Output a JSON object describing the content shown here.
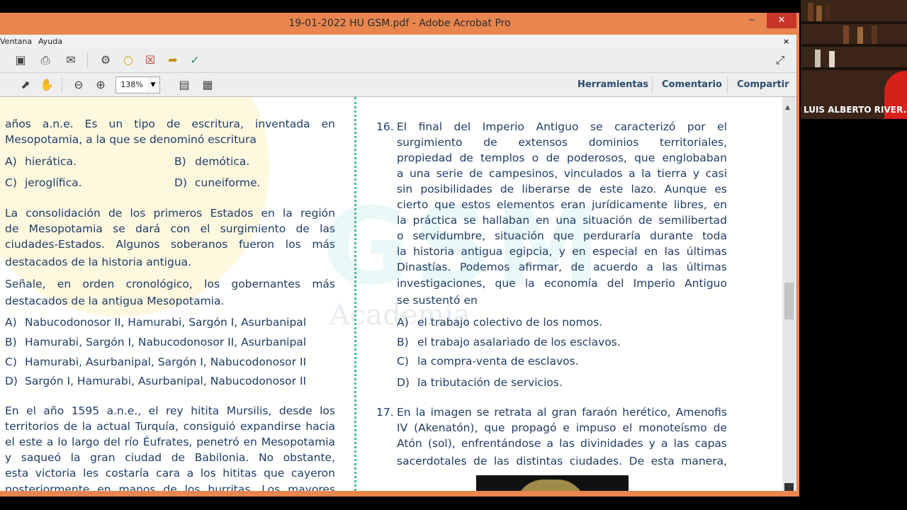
{
  "window": {
    "title": "19-01-2022 HU GSM.pdf - Adobe Acrobat Pro",
    "controls": {
      "minimize": "−",
      "maximize": "□",
      "close": "✕"
    }
  },
  "menu": {
    "items": [
      "Ventana",
      "Ayuda"
    ],
    "doc_close": "×"
  },
  "toolbar": {
    "zoom": "138%",
    "panels": [
      "Herramientas",
      "Comentario",
      "Compartir"
    ]
  },
  "left_column": {
    "intro_lines": [
      "años a.n.e. Es un tipo de escritura, inventada en",
      "Mesopotamia, a la que se denominó escritura"
    ],
    "q1_options": [
      {
        "letter": "A)",
        "text": "hierática."
      },
      {
        "letter": "B)",
        "text": "demótica."
      },
      {
        "letter": "C)",
        "text": "jeroglífica."
      },
      {
        "letter": "D)",
        "text": "cuneiforme."
      }
    ],
    "para1_lines": [
      "La consolidación de los primeros Estados en la región",
      "de Mesopotamia se dará con el surgimiento de las",
      "ciudades-Estados. Algunos soberanos fueron los más",
      "destacados de la historia antigua."
    ],
    "para2_lines": [
      "Señale, en orden cronológico, los gobernantes más",
      "destacados de la antigua Mesopotamia."
    ],
    "q2_options": [
      {
        "letter": "A)",
        "text": "Nabucodonosor II, Hamurabi, Sargón I, Asurbanipal"
      },
      {
        "letter": "B)",
        "text": "Hamurabi, Sargón I, Nabucodonosor II, Asurbanipal"
      },
      {
        "letter": "C)",
        "text": "Hamurabi, Asurbanipal, Sargón I, Nabucodonosor II"
      },
      {
        "letter": "D)",
        "text": "Sargón I, Hamurabi, Asurbanipal, Nabucodonosor II"
      }
    ],
    "para3_lines": [
      "En el año 1595 a.n.e., el rey hitita Mursilis, desde los",
      "territorios de la actual Turquía, consiguió expandirse hacia",
      "el este a lo largo del río Éufrates, penetró en Mesopotamia",
      "y saqueó la gran ciudad de Babilonia. No obstante,",
      "esta victoria les costaría cara a los hititas que cayeron",
      "posteriormente en manos de los hurritas. Los mayores"
    ]
  },
  "right_column": {
    "q16": {
      "number": "16.",
      "lines": [
        "El final del Imperio Antiguo se caracterizó por el",
        "surgimiento de extensos dominios territoriales,",
        "propiedad de templos o de poderosos, que englobaban",
        "a una serie de campesinos, vinculados a la tierra y casi",
        "sin posibilidades de liberarse de este lazo. Aunque es",
        "cierto que estos elementos eran jurídicamente libres, en",
        "la práctica se hallaban en una situación de semilibertad",
        "o servidumbre, situación que perduraría durante toda",
        "la historia antigua egipcia, y en especial en las últimas",
        "Dinastías. Podemos afirmar, de acuerdo a las últimas",
        "investigaciones, que la economía del Imperio Antiguo",
        "se sustentó en"
      ],
      "options": [
        {
          "letter": "A)",
          "text": "el trabajo colectivo de los nomos."
        },
        {
          "letter": "B)",
          "text": "el trabajo asalariado de los esclavos."
        },
        {
          "letter": "C)",
          "text": "la compra-venta de esclavos."
        },
        {
          "letter": "D)",
          "text": "la tributación de servicios."
        }
      ]
    },
    "q17": {
      "number": "17.",
      "lines": [
        "En la imagen se retrata al gran faraón herético, Amenofis",
        "IV (Akenatón), que propagó e impuso el monoteísmo de",
        "Atón (sol), enfrentándose a las divinidades y a las capas",
        "sacerdotales de las distintas ciudades. De esta manera,"
      ]
    }
  },
  "watermark": {
    "logo": "GSM",
    "sub": "Academia"
  },
  "webcam": {
    "name": "LUIS ALBERTO RIVER..."
  },
  "colors": {
    "text": "#1f3d67",
    "divider": "#3cbf8a",
    "window_frame": "#e9864f",
    "panel_link": "#2b4c70"
  }
}
